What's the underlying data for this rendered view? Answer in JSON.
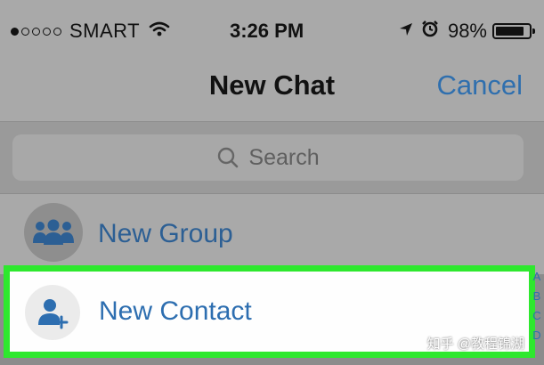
{
  "status_bar": {
    "signal_dots": [
      true,
      false,
      false,
      false,
      false
    ],
    "carrier": "SMART",
    "time": "3:26 PM",
    "battery_percent": "98%",
    "battery_level": 0.98
  },
  "nav": {
    "title": "New Chat",
    "cancel_label": "Cancel"
  },
  "search": {
    "placeholder": "Search"
  },
  "rows": {
    "new_group_label": "New Group",
    "new_contact_label": "New Contact"
  },
  "index_letters": [
    "A",
    "B",
    "C",
    "D"
  ],
  "watermark": "知乎 @教程锦湖",
  "colors": {
    "accent_blue": "#2f6fae",
    "highlight_green": "#2ee82e",
    "dim_overlay": "#a9a9a9"
  },
  "icons": {
    "wifi": "wifi-icon",
    "location": "location-arrow-icon",
    "alarm": "alarm-icon",
    "search": "search-icon",
    "group": "group-icon",
    "add_contact": "add-contact-icon"
  }
}
